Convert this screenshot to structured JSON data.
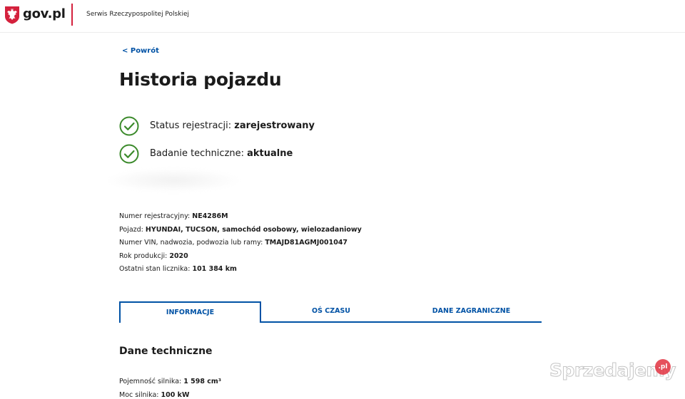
{
  "header": {
    "logo_text": "gov.pl",
    "subtitle": "Serwis Rzeczypospolitej Polskiej"
  },
  "back_link": "< Powrót",
  "page_title": "Historia pojazdu",
  "status": [
    {
      "label": "Status rejestracji: ",
      "value": "zarejestrowany"
    },
    {
      "label": "Badanie techniczne: ",
      "value": "aktualne"
    }
  ],
  "vehicle": [
    {
      "label": "Numer rejestracyjny: ",
      "value": "NE4286M"
    },
    {
      "label": "Pojazd: ",
      "value": "HYUNDAI, TUCSON, samochód osobowy, wielozadaniowy"
    },
    {
      "label": "Numer VIN, nadwozia, podwozia lub ramy: ",
      "value": "TMAJD81AGMJ001047"
    },
    {
      "label": "Rok produkcji: ",
      "value": "2020"
    },
    {
      "label": "Ostatni stan licznika: ",
      "value": "101 384 km"
    }
  ],
  "tabs": [
    {
      "label": "INFORMACJE",
      "active": true
    },
    {
      "label": "OŚ CZASU",
      "active": false
    },
    {
      "label": "DANE ZAGRANICZNE",
      "active": false
    }
  ],
  "section_title": "Dane techniczne",
  "tech": [
    {
      "label": "Pojemność silnika: ",
      "value": "1 598 cm³"
    },
    {
      "label": "Moc silnika: ",
      "value": "100 kW"
    }
  ],
  "watermark": {
    "text": "Sprzedajemy",
    "badge": ".pl"
  },
  "colors": {
    "link": "#0052a5",
    "check": "#3b8a2b",
    "brand_red": "#d4213d"
  },
  "icons": {
    "logo": "polish-eagle-emblem-icon",
    "status": "check-circle-icon"
  }
}
